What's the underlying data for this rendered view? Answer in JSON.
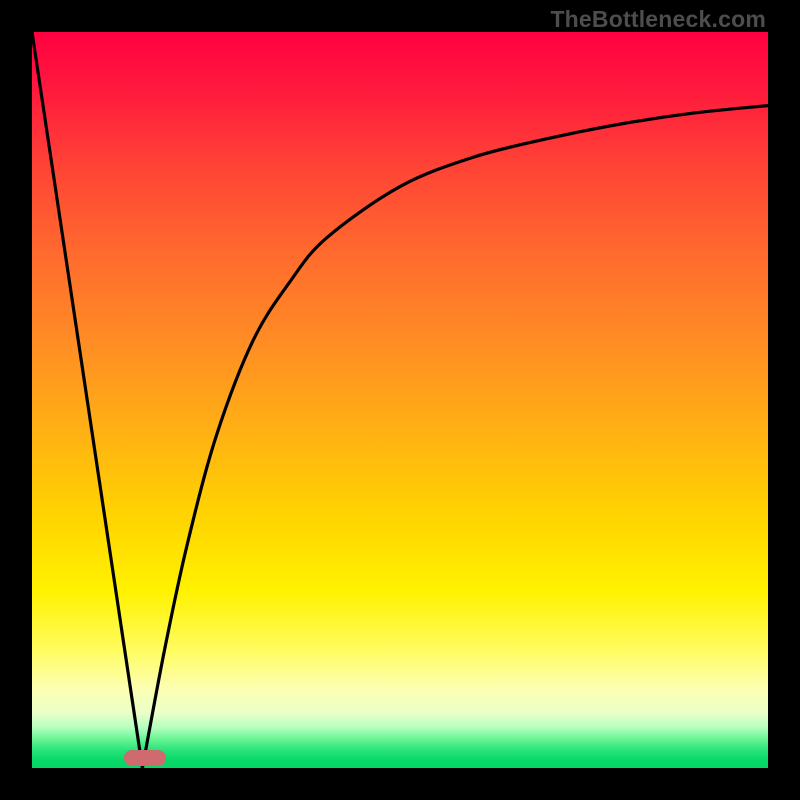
{
  "watermark": "TheBottleneck.com",
  "colors": {
    "frame": "#000000",
    "curve": "#000000",
    "marker": "#cf6a6f",
    "gradient_top": "#ff0040",
    "gradient_bottom": "#05d666"
  },
  "chart_data": {
    "type": "line",
    "title": "",
    "xlabel": "",
    "ylabel": "",
    "xlim": [
      0,
      100
    ],
    "ylim": [
      0,
      100
    ],
    "note": "Axes have no numeric labels in the image; x and y ranges are normalized 0–100. Two branches form a V shape meeting near x≈15, y≈0. Left branch is near-linear descending from (0,100) to the vertex. Right branch rises steeply then asymptotically toward ~90 at x=100.",
    "series": [
      {
        "name": "left-branch",
        "x": [
          0,
          3,
          6,
          9,
          12,
          15
        ],
        "values": [
          100,
          80,
          60,
          40,
          20,
          0
        ]
      },
      {
        "name": "right-branch",
        "x": [
          15,
          18,
          21,
          25,
          30,
          35,
          40,
          50,
          60,
          70,
          80,
          90,
          100
        ],
        "values": [
          0,
          16,
          30,
          45,
          58,
          66,
          72,
          79,
          83,
          85.5,
          87.5,
          89,
          90
        ]
      }
    ],
    "marker": {
      "x_center": 15.3,
      "y": 0,
      "width_pct": 5.7
    }
  }
}
